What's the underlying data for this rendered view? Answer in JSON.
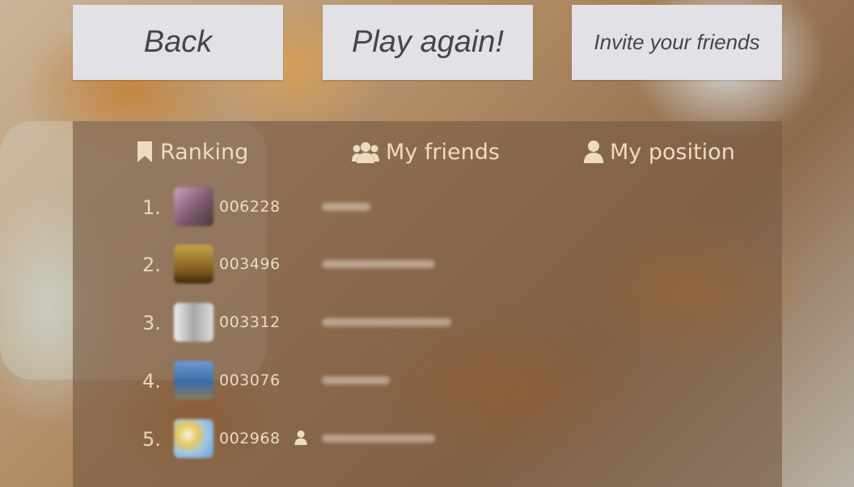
{
  "buttons": {
    "back": "Back",
    "play_again": "Play again!",
    "invite": "Invite your friends"
  },
  "tabs": {
    "ranking": "Ranking",
    "friends": "My friends",
    "position": "My position"
  },
  "ranking": [
    {
      "rank": "1.",
      "score": "006228",
      "is_me": false,
      "avatar_color": "#a27f93"
    },
    {
      "rank": "2.",
      "score": "003496",
      "is_me": false,
      "avatar_color": "#8a6a2e"
    },
    {
      "rank": "3.",
      "score": "003312",
      "is_me": false,
      "avatar_color": "#b8b4b4"
    },
    {
      "rank": "4.",
      "score": "003076",
      "is_me": false,
      "avatar_color": "#5a7ea8"
    },
    {
      "rank": "5.",
      "score": "002968",
      "is_me": true,
      "avatar_color": "#9fc7e6"
    }
  ],
  "icons": {
    "ranking": "bookmark-icon",
    "friends": "users-icon",
    "position": "user-icon",
    "current_player": "user-icon"
  },
  "colors": {
    "button_bg": "#e2e1e5",
    "button_text": "#47444b",
    "panel_overlay": "rgba(122,92,70,0.66)",
    "panel_text": "#ecdcc0"
  }
}
